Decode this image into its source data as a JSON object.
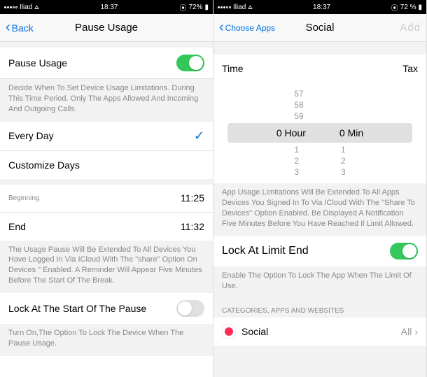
{
  "left": {
    "status": {
      "carrier": "Iliad",
      "time": "18:37",
      "battery": "72%"
    },
    "nav": {
      "back": "Back",
      "title": "Pause Usage"
    },
    "pause": {
      "label": "Pause Usage"
    },
    "desc1": "Decide When To Set Device Usage Limitations. During This Time Period. Only The Apps Allowed And Incoming And Outgoing Calls.",
    "every": "Every Day",
    "custom": "Customize Days",
    "begin": {
      "label": "Beginning",
      "val": "11:25"
    },
    "end": {
      "label": "End",
      "val": "11:32"
    },
    "desc2": "The Usage Pause Will Be Extended To All Devices You Have Logged In Via ICloud With The \"share\" Option On Devices \" Enabled. A Reminder Will Appear Five Minutes Before The Start Of The Break.",
    "lock": "Lock At The Start Of The Pause",
    "desc3": "Turn On,The Option To Lock The Device When The Pause Usage."
  },
  "right": {
    "status": {
      "carrier": "Iliad",
      "time": "18:37",
      "battery": "72 %"
    },
    "nav": {
      "back": "Choose Apps",
      "title": "Social",
      "add": "Add"
    },
    "time": {
      "label": "Time",
      "tax": "Tax"
    },
    "wheel": {
      "r1": [
        "57",
        ""
      ],
      "r2": [
        "58",
        ""
      ],
      "r3": [
        "59",
        ""
      ],
      "sel": [
        "0 Hour",
        "0 Min"
      ],
      "r5": [
        "1",
        "1"
      ],
      "r6": [
        "2",
        "2"
      ],
      "r7": [
        "3",
        "3"
      ]
    },
    "desc1": "App Usage Limitations Will Be Extended To All Apps Devices You Signed In To Via ICloud With The \"Share To Devices\" Option Enabled. Be Displayed A Notification Five Minutes Before You Have Reached Il Limit Allowed.",
    "lock": "Lock At Limit End",
    "desc2": "Enable The Option To Lock The App When The Limit Of Use.",
    "sect": "CATEGORIES, APPS AND WEBSITES",
    "social": {
      "label": "Social",
      "val": "All"
    }
  }
}
